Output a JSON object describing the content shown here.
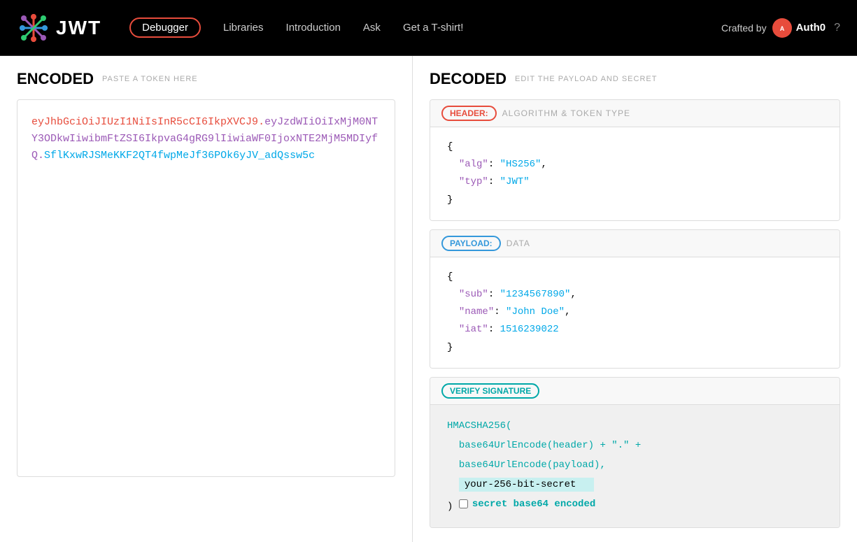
{
  "navbar": {
    "logo_text": "JWT",
    "links": [
      {
        "id": "debugger",
        "label": "Debugger",
        "active": true
      },
      {
        "id": "libraries",
        "label": "Libraries",
        "active": false
      },
      {
        "id": "introduction",
        "label": "Introduction",
        "active": false
      },
      {
        "id": "ask",
        "label": "Ask",
        "active": false
      },
      {
        "id": "tshirt",
        "label": "Get a T-shirt!",
        "active": false
      }
    ],
    "crafted_by": "Crafted by",
    "auth0_name": "Auth0"
  },
  "encoded": {
    "title": "Encoded",
    "subtitle": "PASTE A TOKEN HERE",
    "token": {
      "part1": "eyJhbGciOiJIUzI1NiIsInR5cCI6IkpXVCJ9",
      "dot1": ".",
      "part2": "eyJzdWIiOiIxMjM0NTY3ODkwIiwibmFtZSI6IkpvaG4gRG9lIiwiaWF0IjoxNTE2MjM5MDIyfQ",
      "dot2": ".",
      "part3": "SflKxwRJSMeKKF2QT4fwpMeJf36POk6yJV_adQssw5c"
    }
  },
  "decoded": {
    "title": "Decoded",
    "subtitle": "EDIT THE PAYLOAD AND SECRET",
    "header": {
      "badge": "HEADER:",
      "label": "ALGORITHM & TOKEN TYPE",
      "alg": "HS256",
      "typ": "JWT"
    },
    "payload": {
      "badge": "PAYLOAD:",
      "label": "DATA",
      "sub": "1234567890",
      "name": "John Doe",
      "iat": 1516239022
    },
    "verify": {
      "badge": "VERIFY SIGNATURE",
      "func": "HMACSHA256(",
      "line1": "base64UrlEncode(header) + \".\" +",
      "line2": "base64UrlEncode(payload),",
      "secret_placeholder": "your-256-bit-secret",
      "close": ")",
      "checkbox_label": "secret base64 encoded"
    }
  }
}
